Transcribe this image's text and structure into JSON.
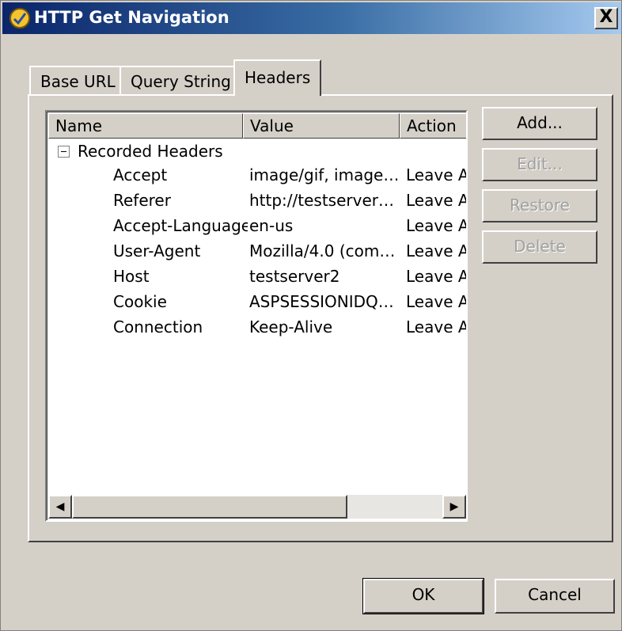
{
  "window": {
    "title": "HTTP Get Navigation",
    "close_label": "X"
  },
  "tabs": [
    {
      "label": "Base URL",
      "active": false
    },
    {
      "label": "Query String",
      "active": false
    },
    {
      "label": "Headers",
      "active": true
    }
  ],
  "list": {
    "columns": [
      "Name",
      "Value",
      "Action"
    ],
    "group_label": "Recorded Headers",
    "group_expanded": true,
    "rows": [
      {
        "name": "Accept",
        "value": "image/gif, image…",
        "action": "Leave A"
      },
      {
        "name": "Referer",
        "value": "http://testserver…",
        "action": "Leave A"
      },
      {
        "name": "Accept-Language",
        "value": "en-us",
        "action": "Leave A"
      },
      {
        "name": "User-Agent",
        "value": "Mozilla/4.0 (com…",
        "action": "Leave A"
      },
      {
        "name": "Host",
        "value": "testserver2",
        "action": "Leave A"
      },
      {
        "name": "Cookie",
        "value": "ASPSESSIONIDQ…",
        "action": "Leave A"
      },
      {
        "name": "Connection",
        "value": "Keep-Alive",
        "action": "Leave A"
      }
    ]
  },
  "side_buttons": {
    "add": "Add...",
    "edit": "Edit...",
    "restore": "Restore",
    "delete": "Delete"
  },
  "dialog_buttons": {
    "ok": "OK",
    "cancel": "Cancel"
  },
  "icons": {
    "app": "http-get-navigation-icon",
    "scroll_left": "scroll-left-arrow-icon",
    "scroll_right": "scroll-right-arrow-icon"
  },
  "colors": {
    "titlebar_start": "#0a246a",
    "titlebar_end": "#a6caf0",
    "face": "#d4d0c8"
  }
}
